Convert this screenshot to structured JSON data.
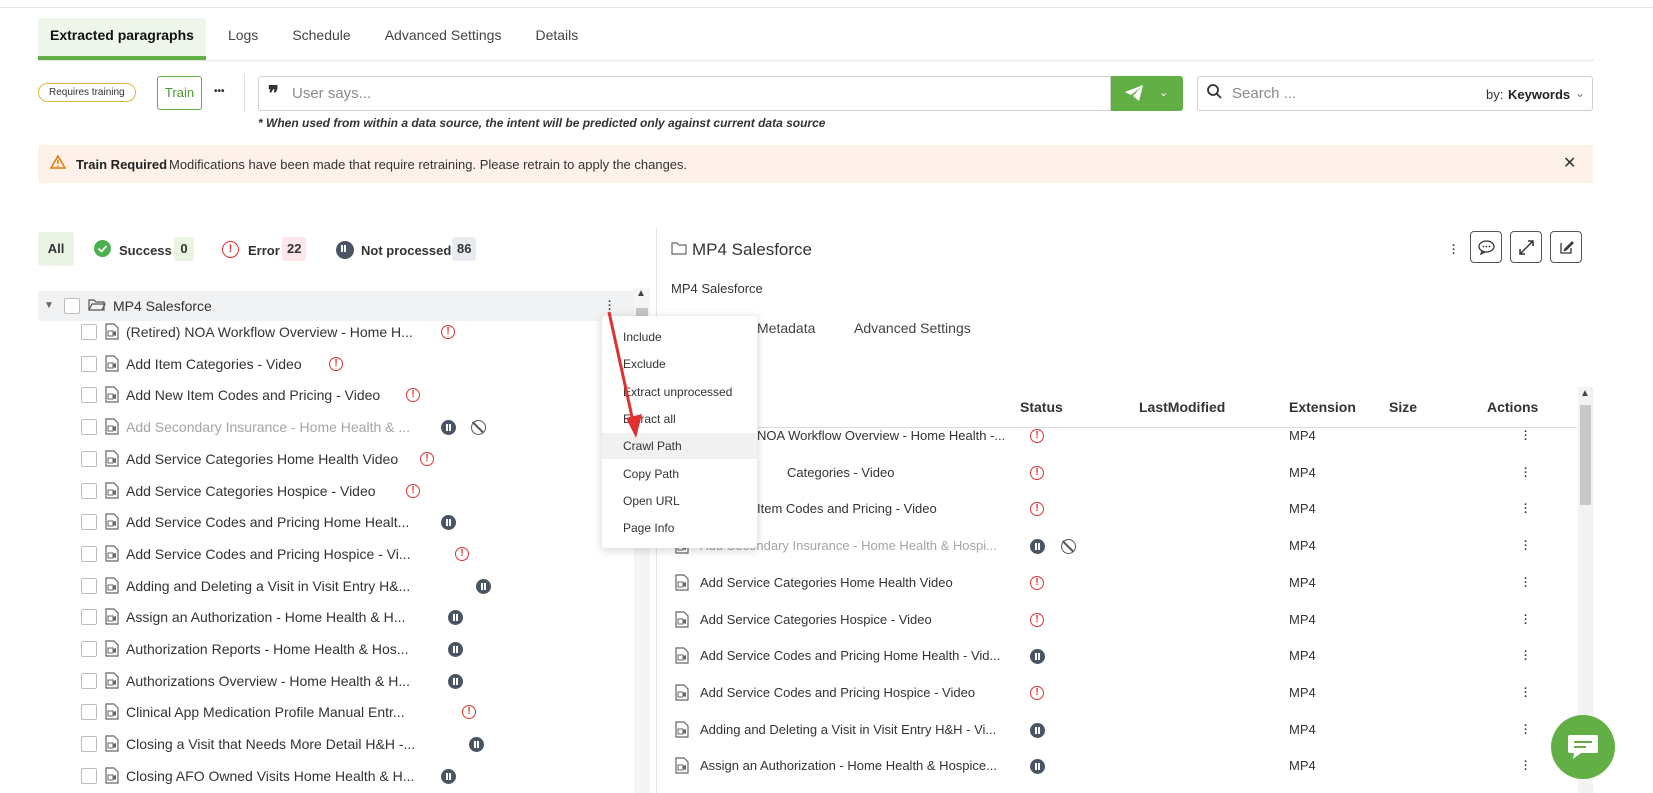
{
  "tabs": [
    {
      "label": "Extracted paragraphs"
    },
    {
      "label": "Logs"
    },
    {
      "label": "Schedule"
    },
    {
      "label": "Advanced Settings"
    },
    {
      "label": "Details"
    }
  ],
  "toolbar": {
    "badge": "Requires training",
    "train_label": "Train",
    "more_label": "•••",
    "says_placeholder": "User says...",
    "search_placeholder": "Search ...",
    "by_label": "by:",
    "by_value": "Keywords",
    "note": "* When used from within a data source, the intent will be predicted only against current data source"
  },
  "alert": {
    "title": "Train Required",
    "message": "Modifications have been made that require retraining. Please retrain to apply the changes."
  },
  "filters": {
    "all": "All",
    "success": {
      "label": "Success",
      "count": "0"
    },
    "error": {
      "label": "Error",
      "count": "22"
    },
    "not_processed": {
      "label": "Not processed",
      "count": "86"
    }
  },
  "tree": {
    "folder": "MP4 Salesforce",
    "rows": [
      {
        "label": "(Retired) NOA Workflow Overview - Home H...",
        "status": "error",
        "muted": false
      },
      {
        "label": "Add Item Categories - Video",
        "status": "error",
        "muted": false
      },
      {
        "label": "Add New Item Codes and Pricing - Video",
        "status": "error",
        "muted": false
      },
      {
        "label": "Add Secondary Insurance - Home Health & ...",
        "status": "paused",
        "muted": true
      },
      {
        "label": "Add Service Categories Home Health Video",
        "status": "error",
        "muted": false
      },
      {
        "label": "Add Service Categories Hospice - Video",
        "status": "error",
        "muted": false
      },
      {
        "label": "Add Service Codes and Pricing Home Healt...",
        "status": "paused",
        "muted": false
      },
      {
        "label": "Add Service Codes and Pricing Hospice - Vi...",
        "status": "error",
        "muted": false
      },
      {
        "label": "Adding and Deleting a Visit in Visit Entry H&...",
        "status": "paused",
        "muted": false
      },
      {
        "label": "Assign an Authorization - Home Health & H...",
        "status": "paused",
        "muted": false
      },
      {
        "label": "Authorization Reports - Home Health & Hos...",
        "status": "paused",
        "muted": false
      },
      {
        "label": "Authorizations Overview - Home Health & H...",
        "status": "paused",
        "muted": false
      },
      {
        "label": "Clinical App Medication Profile Manual Entr...",
        "status": "error",
        "muted": false
      },
      {
        "label": "Closing a Visit that Needs More Detail H&H -...",
        "status": "paused",
        "muted": false
      },
      {
        "label": "Closing AFO Owned Visits Home Health & H...",
        "status": "paused",
        "muted": false
      }
    ]
  },
  "context_menu": {
    "items": [
      "Include",
      "Exclude",
      "Extract unprocessed",
      "Extract all",
      "Crawl Path",
      "Copy Path",
      "Open URL",
      "Page Info"
    ],
    "highlighted": "Crawl Path"
  },
  "right_panel": {
    "title": "MP4 Salesforce",
    "subtitle": "MP4 Salesforce",
    "tabs": [
      "Metadata",
      "Advanced Settings"
    ],
    "columns": [
      "Status",
      "LastModified",
      "Extension",
      "Size",
      "Actions"
    ],
    "rows": [
      {
        "name": "NOA Workflow Overview - Home Health -...",
        "status": "error",
        "ext": "MP4",
        "muted": false,
        "partial": true
      },
      {
        "name": "Categories - Video",
        "status": "error",
        "ext": "MP4",
        "muted": false,
        "partial": true
      },
      {
        "name": "Item Codes and Pricing - Video",
        "status": "error",
        "ext": "MP4",
        "muted": false,
        "partial": true
      },
      {
        "name": "Add Secondary Insurance - Home Health & Hospi...",
        "status": "paused",
        "ext": "MP4",
        "muted": true,
        "partial": false
      },
      {
        "name": "Add Service Categories Home Health Video",
        "status": "error",
        "ext": "MP4",
        "muted": false,
        "partial": false
      },
      {
        "name": "Add Service Categories Hospice - Video",
        "status": "error",
        "ext": "MP4",
        "muted": false,
        "partial": false
      },
      {
        "name": "Add Service Codes and Pricing Home Health - Vid...",
        "status": "paused",
        "ext": "MP4",
        "muted": false,
        "partial": false
      },
      {
        "name": "Add Service Codes and Pricing Hospice - Video",
        "status": "error",
        "ext": "MP4",
        "muted": false,
        "partial": false
      },
      {
        "name": "Adding and Deleting a Visit in Visit Entry H&H - Vi...",
        "status": "paused",
        "ext": "MP4",
        "muted": false,
        "partial": false
      },
      {
        "name": "Assign an Authorization - Home Health & Hospice...",
        "status": "paused",
        "ext": "MP4",
        "muted": false,
        "partial": false
      }
    ]
  },
  "colors": {
    "accent": "#62b045",
    "error": "#e03131",
    "alert_bg": "#fdf1e9"
  }
}
